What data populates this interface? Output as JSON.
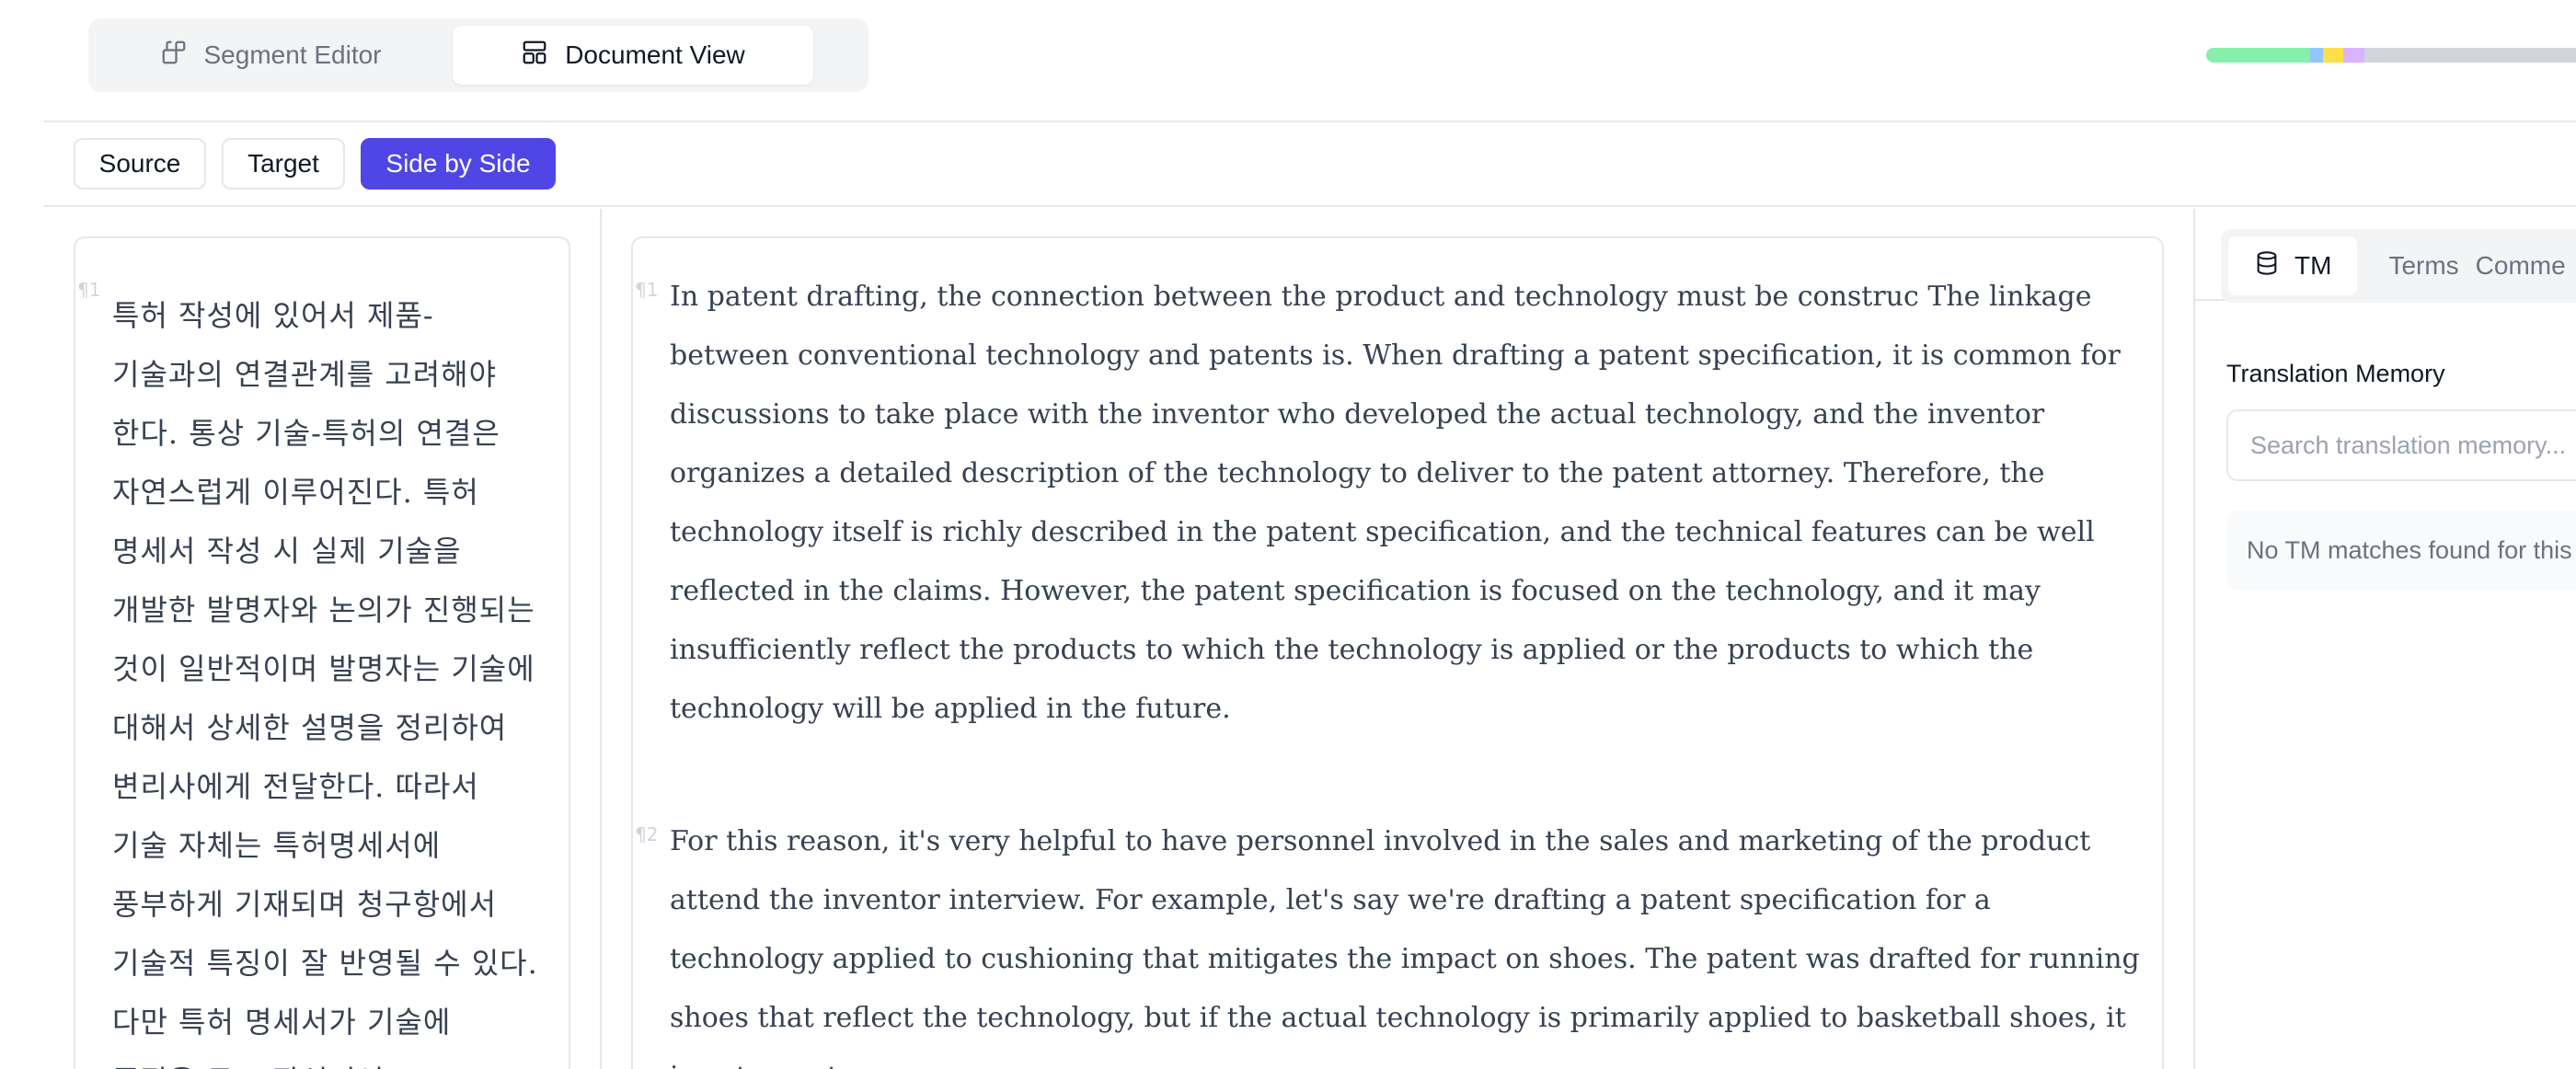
{
  "header": {
    "view_toggle": {
      "segment_editor": "Segment Editor",
      "document_view": "Document View"
    },
    "progress": [
      {
        "status": "confirmed",
        "color": "#86efac",
        "fraction": 0.25
      },
      {
        "status": "translated",
        "color": "#93c5fd",
        "fraction": 0.03
      },
      {
        "status": "in-progress",
        "color": "#fde047",
        "fraction": 0.05
      },
      {
        "status": "reviewed",
        "color": "#d8b4fe",
        "fraction": 0.05
      },
      {
        "status": "untranslated",
        "color": "#d1d5db",
        "fraction": 0.62
      }
    ]
  },
  "modes": {
    "source": "Source",
    "target": "Target",
    "side_by_side": "Side by Side",
    "active": "side_by_side"
  },
  "document": {
    "paragraph_mark_1": "¶1",
    "paragraph_mark_2": "¶2",
    "source_paragraphs": [
      "특허 작성에 있어서 제품-기술과의 연결관계를 고려해야 한다. 통상 기술-특허의 연결은 자연스럽게 이루어진다. 특허 명세서 작성 시 실제 기술을 개발한 발명자와 논의가 진행되는 것이 일반적이며 발명자는 기술에 대해서 상세한 설명을 정리하여 변리사에게 전달한다. 따라서 기술 자체는 특허명세서에 풍부하게 기재되며 청구항에서 기술적 특징이 잘 반영될 수 있다. 다만 특허 명세서가 기술에 중점을 두고 작성되어"
    ],
    "target_paragraphs": [
      "In patent drafting, the connection between the product and technology must be construc The linkage between conventional technology and patents is. When drafting a patent specification, it is common for discussions to take place with the inventor who developed the actual technology, and the inventor organizes a detailed description of the technology to deliver to the patent attorney. Therefore, the technology itself is richly described in the patent specification, and the technical features can be well reflected in the claims. However, the patent specification is focused on the technology, and it may insufficiently reflect the products to which the technology is applied or the products to which the technology will be applied in the future.",
      "For this reason, it's very helpful to have personnel involved in the sales and marketing of the product attend the inventor interview. For example, let's say we're drafting a patent specification for a technology applied to cushioning that mitigates the impact on shoes. The patent was drafted for running shoes that reflect the technology, but if the actual technology is primarily applied to basketball shoes, it is not easy to"
    ]
  },
  "panel": {
    "tabs": {
      "tm": "TM",
      "terms": "Terms",
      "comments": "Comme"
    },
    "tm_title": "Translation Memory",
    "search_placeholder": "Search translation memory...",
    "empty_message": "No TM matches found for this segment"
  },
  "colors": {
    "accent": "#4f46e5",
    "border": "#e5e7eb"
  }
}
